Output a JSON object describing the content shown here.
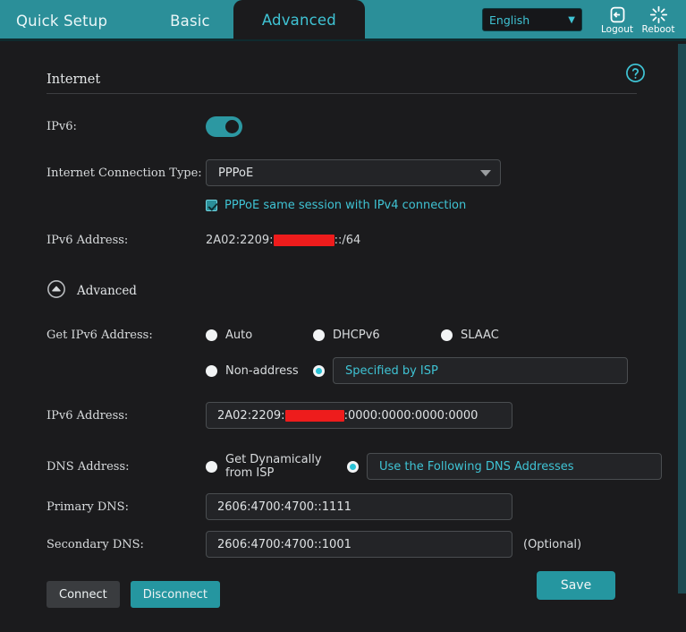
{
  "nav": {
    "tabs": [
      {
        "label": "Quick Setup",
        "active": false
      },
      {
        "label": "Basic",
        "active": false
      },
      {
        "label": "Advanced",
        "active": true
      }
    ],
    "language": "English",
    "logout_label": "Logout",
    "reboot_label": "Reboot"
  },
  "page": {
    "section_title": "Internet",
    "help_icon": "question-mark-circle-icon"
  },
  "form": {
    "ipv6_label": "IPv6:",
    "ipv6_enabled": true,
    "conn_type_label": "Internet Connection Type:",
    "conn_type_value": "PPPoE",
    "same_session_label": "PPPoE same session with IPv4 connection",
    "same_session_checked": true,
    "ipv6_addr_label": "IPv6 Address:",
    "ipv6_addr_prefix": "2A02:2209:",
    "ipv6_addr_suffix": "::/64",
    "advanced_label": "Advanced",
    "get_ipv6_label": "Get IPv6 Address:",
    "get_ipv6_options": [
      {
        "label": "Auto",
        "selected": false
      },
      {
        "label": "DHCPv6",
        "selected": false
      },
      {
        "label": "SLAAC",
        "selected": false
      },
      {
        "label": "Non-address",
        "selected": false
      },
      {
        "label": "Specified by ISP",
        "selected": true
      }
    ],
    "ipv6_addr_field_label": "IPv6 Address:",
    "ipv6_addr_field_prefix": "2A02:2209:",
    "ipv6_addr_field_suffix": ":0000:0000:0000:0000",
    "dns_label": "DNS Address:",
    "dns_options": [
      {
        "label": "Get Dynamically from ISP",
        "selected": false
      },
      {
        "label": "Use the Following DNS Addresses",
        "selected": true
      }
    ],
    "primary_dns_label": "Primary DNS:",
    "primary_dns_value": "2606:4700:4700::1111",
    "secondary_dns_label": "Secondary DNS:",
    "secondary_dns_value": "2606:4700:4700::1001",
    "optional_note": "(Optional)",
    "connect_label": "Connect",
    "disconnect_label": "Disconnect",
    "save_label": "Save"
  },
  "colors": {
    "accent": "#2b8f99",
    "accent_text": "#3fc3d4",
    "background": "#1b1b1d",
    "redaction": "#ee1c1c"
  }
}
